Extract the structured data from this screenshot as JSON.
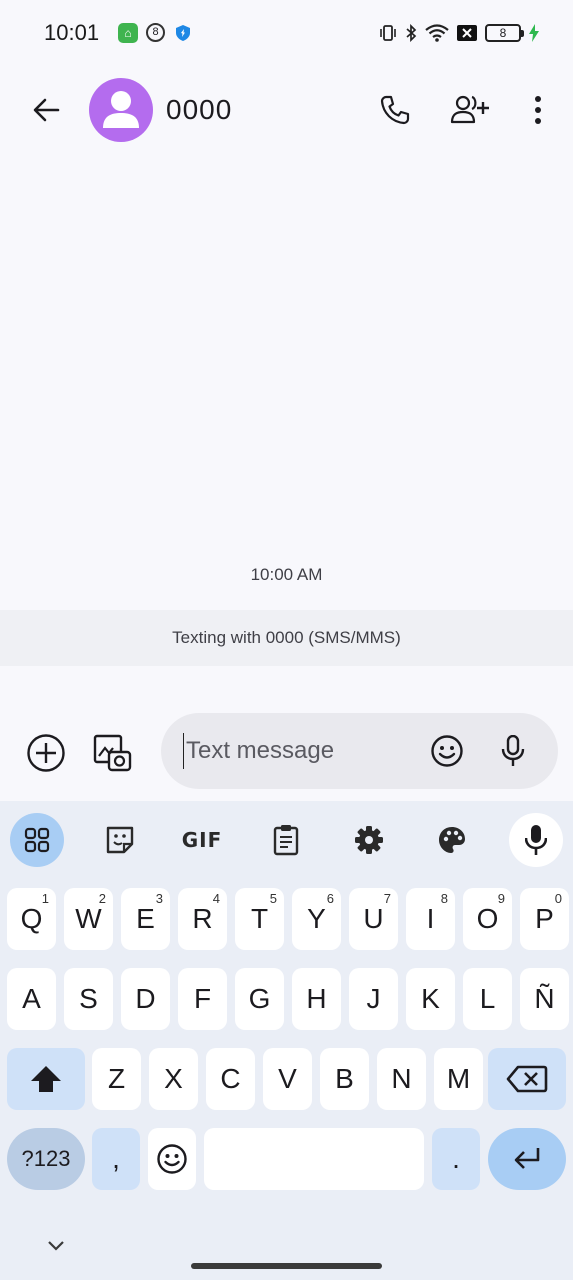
{
  "status_bar": {
    "time": "10:01",
    "notif_badge": "8",
    "battery_level": "8"
  },
  "app_bar": {
    "contact_name": "0000",
    "avatar_color": "#b46cee"
  },
  "conversation": {
    "timestamp": "10:00 AM",
    "sms_banner": "Texting with 0000 (SMS/MMS)"
  },
  "compose": {
    "placeholder": "Text message"
  },
  "keyboard": {
    "toolbar": {
      "gif_label": "GIF"
    },
    "row1": [
      {
        "label": "Q",
        "hint": "1"
      },
      {
        "label": "W",
        "hint": "2"
      },
      {
        "label": "E",
        "hint": "3"
      },
      {
        "label": "R",
        "hint": "4"
      },
      {
        "label": "T",
        "hint": "5"
      },
      {
        "label": "Y",
        "hint": "6"
      },
      {
        "label": "U",
        "hint": "7"
      },
      {
        "label": "I",
        "hint": "8"
      },
      {
        "label": "O",
        "hint": "9"
      },
      {
        "label": "P",
        "hint": "0"
      }
    ],
    "row2": [
      "A",
      "S",
      "D",
      "F",
      "G",
      "H",
      "J",
      "K",
      "L",
      "Ñ"
    ],
    "row3": [
      "Z",
      "X",
      "C",
      "V",
      "B",
      "N",
      "M"
    ],
    "row4": {
      "symbols": "?123",
      "comma": ",",
      "period": "."
    }
  },
  "colors": {
    "accent": "#a8cdf4",
    "background": "#f8f8fc",
    "banner": "#eff0f4",
    "keyboard": "#eaeef6"
  }
}
